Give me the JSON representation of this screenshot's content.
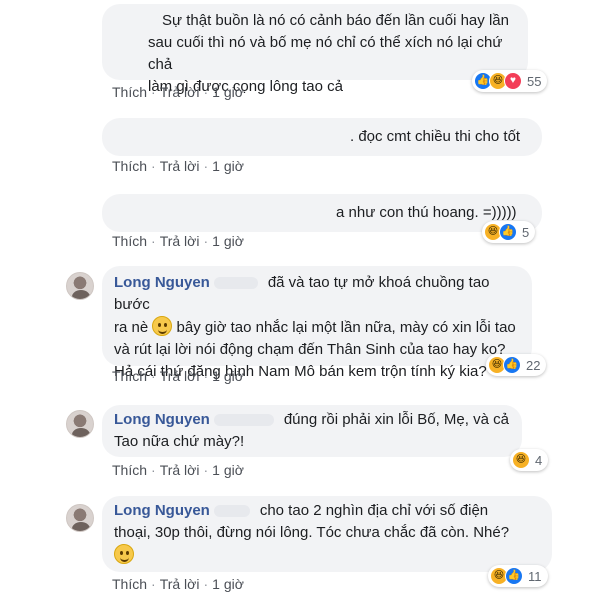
{
  "comments": [
    {
      "text_lines": [
        "Sự thật buồn là nó có cảnh báo đến lần cuối hay lần",
        "sau cuối thì nó và bố mẹ nó chỉ có thể xích nó lại chứ chả",
        "làm gì được cọng lông tao cả"
      ],
      "like": "Thích",
      "reply": "Trả lời",
      "time": "1 giờ",
      "reaction_icons": [
        "like-icon",
        "haha-icon",
        "love-icon"
      ],
      "reaction_count": "55"
    },
    {
      "text": ". đọc cmt chiều thi cho tốt",
      "like": "Thích",
      "reply": "Trả lời",
      "time": "1 giờ"
    },
    {
      "text": "a như con thú hoang. =)))))",
      "like": "Thích",
      "reply": "Trả lời",
      "time": "1 giờ",
      "reaction_icons": [
        "haha-icon",
        "like-icon"
      ],
      "reaction_count": "5"
    },
    {
      "author": "Long Nguyen",
      "text_line1": "đã và tao tự mở khoá chuồng tao bước",
      "text_line2a": "ra nè",
      "text_line2b": "bây giờ tao nhắc lại một lần nữa, mày có xin lỗi tao",
      "text_line3": "và rút lại lời nói động chạm đến Thân Sinh của tao hay ko?",
      "text_line4": "Hả cái thứ đăng hình Nam Mô bán kem trộn tính ký kia?",
      "like": "Thích",
      "reply": "Trả lời",
      "time": "1 giờ",
      "reaction_icons": [
        "haha-icon",
        "like-icon"
      ],
      "reaction_count": "22"
    },
    {
      "author": "Long Nguyen",
      "text_line1": "đúng rồi phải xin lỗi Bố, Mẹ, và cả",
      "text_line2": "Tao nữa chứ mày?!",
      "like": "Thích",
      "reply": "Trả lời",
      "time": "1 giờ",
      "reaction_icons": [
        "haha-icon"
      ],
      "reaction_count": "4"
    },
    {
      "author": "Long Nguyen",
      "text_line1": "cho tao 2 nghìn địa chỉ với số điện",
      "text_line2": "thoại, 30p thôi, đừng nói lông. Tóc chưa chắc đã còn. Nhé?",
      "like": "Thích",
      "reply": "Trả lời",
      "time": "1 giờ",
      "reaction_icons": [
        "haha-icon",
        "like-icon"
      ],
      "reaction_count": "11"
    }
  ],
  "colors": {
    "link": "#385898",
    "bubble": "#f2f3f5",
    "meta": "#606770",
    "like": "#1877f2",
    "haha": "#f7b125",
    "love": "#f33e58"
  }
}
